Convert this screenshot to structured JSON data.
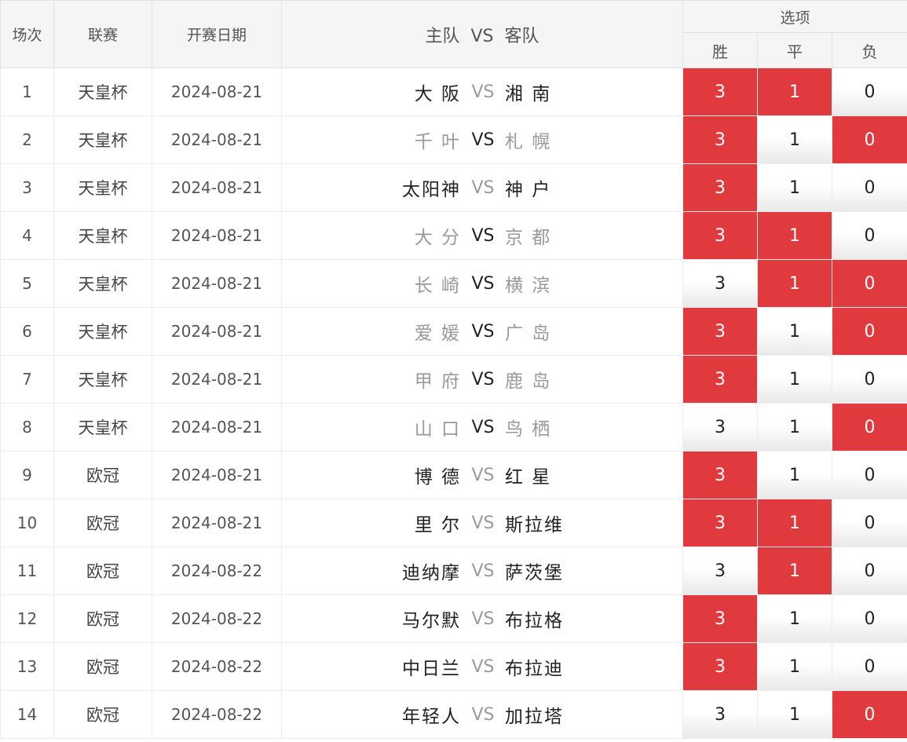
{
  "header": {
    "no": "场次",
    "league": "联赛",
    "date": "开赛日期",
    "home": "主队",
    "vs": "VS",
    "away": "客队",
    "options": "选项",
    "win": "胜",
    "draw": "平",
    "lose": "负"
  },
  "colors": {
    "selected": "#e0393e",
    "dim_text": "#9a9a9a"
  },
  "rows": [
    {
      "no": "1",
      "league": "天皇杯",
      "date": "2024-08-21",
      "home": "大 阪",
      "away": "湘 南",
      "teams_dim": false,
      "vs_dim": true,
      "win": "3",
      "draw": "1",
      "lose": "0",
      "sel": [
        true,
        true,
        false
      ]
    },
    {
      "no": "2",
      "league": "天皇杯",
      "date": "2024-08-21",
      "home": "千 叶",
      "away": "札 幌",
      "teams_dim": true,
      "vs_dim": false,
      "win": "3",
      "draw": "1",
      "lose": "0",
      "sel": [
        true,
        false,
        true
      ]
    },
    {
      "no": "3",
      "league": "天皇杯",
      "date": "2024-08-21",
      "home": "太阳神",
      "away": "神 户",
      "teams_dim": false,
      "vs_dim": true,
      "win": "3",
      "draw": "1",
      "lose": "0",
      "sel": [
        true,
        false,
        false
      ]
    },
    {
      "no": "4",
      "league": "天皇杯",
      "date": "2024-08-21",
      "home": "大 分",
      "away": "京 都",
      "teams_dim": true,
      "vs_dim": false,
      "win": "3",
      "draw": "1",
      "lose": "0",
      "sel": [
        true,
        true,
        false
      ]
    },
    {
      "no": "5",
      "league": "天皇杯",
      "date": "2024-08-21",
      "home": "长 崎",
      "away": "横 滨",
      "teams_dim": true,
      "vs_dim": false,
      "win": "3",
      "draw": "1",
      "lose": "0",
      "sel": [
        false,
        true,
        true
      ]
    },
    {
      "no": "6",
      "league": "天皇杯",
      "date": "2024-08-21",
      "home": "爱 媛",
      "away": "广 岛",
      "teams_dim": true,
      "vs_dim": false,
      "win": "3",
      "draw": "1",
      "lose": "0",
      "sel": [
        true,
        false,
        true
      ]
    },
    {
      "no": "7",
      "league": "天皇杯",
      "date": "2024-08-21",
      "home": "甲 府",
      "away": "鹿 岛",
      "teams_dim": true,
      "vs_dim": false,
      "win": "3",
      "draw": "1",
      "lose": "0",
      "sel": [
        true,
        false,
        false
      ]
    },
    {
      "no": "8",
      "league": "天皇杯",
      "date": "2024-08-21",
      "home": "山 口",
      "away": "鸟 栖",
      "teams_dim": true,
      "vs_dim": false,
      "win": "3",
      "draw": "1",
      "lose": "0",
      "sel": [
        false,
        false,
        true
      ]
    },
    {
      "no": "9",
      "league": "欧冠",
      "date": "2024-08-21",
      "home": "博 德",
      "away": "红 星",
      "teams_dim": false,
      "vs_dim": true,
      "win": "3",
      "draw": "1",
      "lose": "0",
      "sel": [
        true,
        false,
        false
      ]
    },
    {
      "no": "10",
      "league": "欧冠",
      "date": "2024-08-21",
      "home": "里 尔",
      "away": "斯拉维",
      "teams_dim": false,
      "vs_dim": true,
      "win": "3",
      "draw": "1",
      "lose": "0",
      "sel": [
        true,
        true,
        false
      ]
    },
    {
      "no": "11",
      "league": "欧冠",
      "date": "2024-08-22",
      "home": "迪纳摩",
      "away": "萨茨堡",
      "teams_dim": false,
      "vs_dim": true,
      "win": "3",
      "draw": "1",
      "lose": "0",
      "sel": [
        false,
        true,
        false
      ]
    },
    {
      "no": "12",
      "league": "欧冠",
      "date": "2024-08-22",
      "home": "马尔默",
      "away": "布拉格",
      "teams_dim": false,
      "vs_dim": true,
      "win": "3",
      "draw": "1",
      "lose": "0",
      "sel": [
        true,
        false,
        false
      ]
    },
    {
      "no": "13",
      "league": "欧冠",
      "date": "2024-08-22",
      "home": "中日兰",
      "away": "布拉迪",
      "teams_dim": false,
      "vs_dim": true,
      "win": "3",
      "draw": "1",
      "lose": "0",
      "sel": [
        true,
        false,
        false
      ]
    },
    {
      "no": "14",
      "league": "欧冠",
      "date": "2024-08-22",
      "home": "年轻人",
      "away": "加拉塔",
      "teams_dim": false,
      "vs_dim": true,
      "win": "3",
      "draw": "1",
      "lose": "0",
      "sel": [
        false,
        false,
        true
      ]
    }
  ]
}
